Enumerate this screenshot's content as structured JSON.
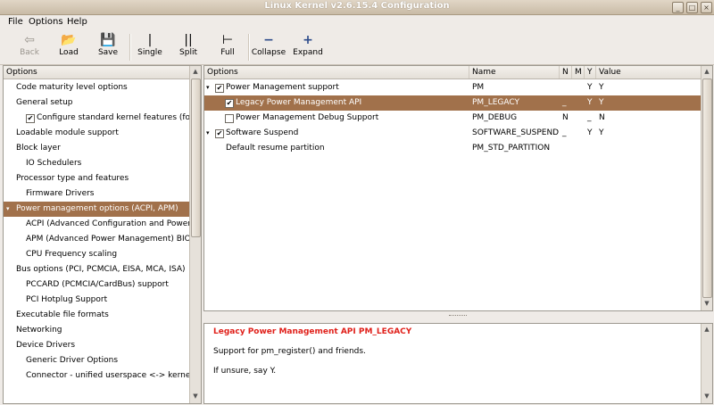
{
  "window": {
    "title": "Linux Kernel v2.6.15.4 Configuration",
    "minimize_glyph": "_",
    "maximize_glyph": "□",
    "close_glyph": "×"
  },
  "menubar": {
    "items": [
      "File",
      "Options",
      "Help"
    ]
  },
  "toolbar": {
    "back": {
      "label": "Back",
      "icon": "back-arrow-icon",
      "glyph": "⇦"
    },
    "load": {
      "label": "Load",
      "icon": "folder-icon",
      "glyph": "📂"
    },
    "save": {
      "label": "Save",
      "icon": "floppy-icon",
      "glyph": "💾"
    },
    "single": {
      "label": "Single",
      "icon": "single-view-icon",
      "glyph": "|"
    },
    "split": {
      "label": "Split",
      "icon": "split-view-icon",
      "glyph": "||"
    },
    "full": {
      "label": "Full",
      "icon": "full-view-icon",
      "glyph": "⊢"
    },
    "collapse": {
      "label": "Collapse",
      "icon": "minus-icon",
      "glyph": "−"
    },
    "expand": {
      "label": "Expand",
      "icon": "plus-icon",
      "glyph": "+"
    }
  },
  "left_tree": {
    "header": "Options",
    "items": [
      {
        "label": "Code maturity level options"
      },
      {
        "label": "General setup"
      },
      {
        "label": "Configure standard kernel features (for",
        "checked": "✔"
      },
      {
        "label": "Loadable module support"
      },
      {
        "label": "Block layer"
      },
      {
        "label": "IO Schedulers"
      },
      {
        "label": "Processor type and features"
      },
      {
        "label": "Firmware Drivers"
      },
      {
        "label": "Power management options (ACPI, APM)",
        "expander": "▾"
      },
      {
        "label": "ACPI (Advanced Configuration and Power"
      },
      {
        "label": "APM (Advanced Power Management) BIOS"
      },
      {
        "label": "CPU Frequency scaling"
      },
      {
        "label": "Bus options (PCI, PCMCIA, EISA, MCA, ISA)"
      },
      {
        "label": "PCCARD (PCMCIA/CardBus) support"
      },
      {
        "label": "PCI Hotplug Support"
      },
      {
        "label": "Executable file formats"
      },
      {
        "label": "Networking"
      },
      {
        "label": "Device Drivers"
      },
      {
        "label": "Generic Driver Options"
      },
      {
        "label": "Connector - unified userspace <-> kernel"
      }
    ]
  },
  "right_table": {
    "headers": {
      "options": "Options",
      "name": "Name",
      "n": "N",
      "m": "M",
      "y": "Y",
      "value": "Value"
    },
    "rows": [
      {
        "expander": "▾",
        "checked": "✔",
        "option": "Power Management support",
        "name": "PM",
        "n": "",
        "m": "",
        "y": "Y",
        "value": "Y"
      },
      {
        "expander": "",
        "checked": "✔",
        "option": "Legacy Power Management API",
        "name": "PM_LEGACY",
        "n": "_",
        "m": "",
        "y": "Y",
        "value": "Y"
      },
      {
        "expander": "",
        "checked": "",
        "option": "Power Management Debug Support",
        "name": "PM_DEBUG",
        "n": "N",
        "m": "",
        "y": "_",
        "value": "N"
      },
      {
        "expander": "▾",
        "checked": "✔",
        "option": "Software Suspend",
        "name": "SOFTWARE_SUSPEND",
        "n": "_",
        "m": "",
        "y": "Y",
        "value": "Y"
      },
      {
        "expander": "",
        "checked": "",
        "option": "Default resume partition",
        "name": "PM_STD_PARTITION",
        "n": "",
        "m": "",
        "y": "",
        "value": ""
      }
    ]
  },
  "help": {
    "title": "Legacy Power Management API PM_LEGACY",
    "line1": "Support for pm_register() and friends.",
    "line2": "If unsure, say Y."
  },
  "colors": {
    "selection": "#a1714b",
    "help_title": "#e0201a"
  }
}
